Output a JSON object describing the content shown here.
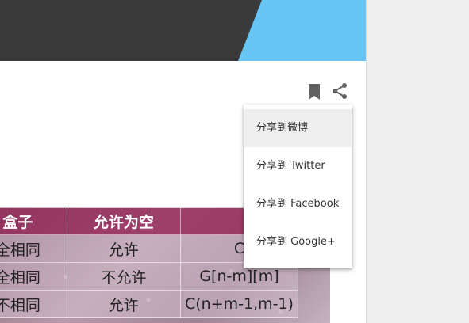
{
  "article": {
    "actions": {
      "bookmark_icon": "bookmark-icon",
      "share_icon": "share-icon"
    },
    "table": {
      "headers": [
        "盒子",
        "允许为空",
        ""
      ],
      "rows": [
        [
          "全相同",
          "允许",
          "C"
        ],
        [
          "全相同",
          "不允许",
          "G[n-m][m]"
        ],
        [
          "不相同",
          "允许",
          "C(n+m-1,m-1)"
        ]
      ]
    }
  },
  "share_menu": {
    "items": [
      {
        "label": "分享到微博"
      },
      {
        "label": "分享到 Twitter"
      },
      {
        "label": "分享到 Facebook"
      },
      {
        "label": "分享到 Google+"
      }
    ]
  },
  "colors": {
    "banner_blue": "#67c5f5",
    "banner_dark": "#3a3a3a",
    "table_header": "#96285a",
    "menu_hover": "#eeeeee"
  }
}
